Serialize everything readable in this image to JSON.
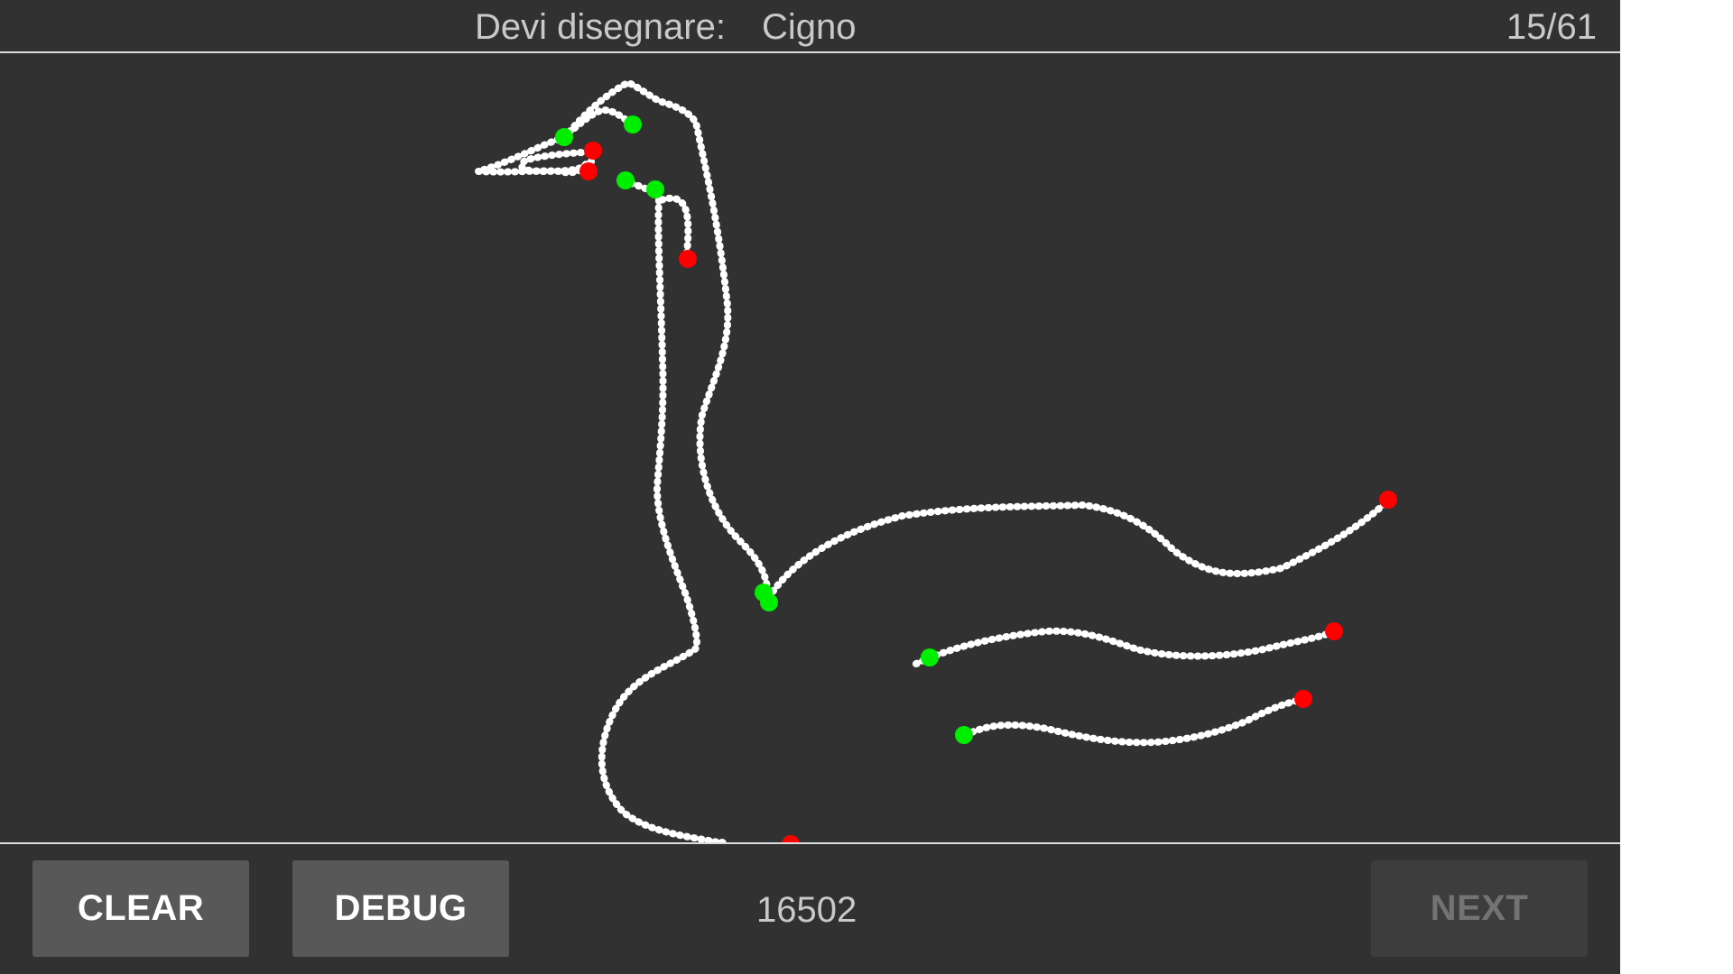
{
  "header": {
    "prompt_label": "Devi disegnare:",
    "prompt_word": "Cigno",
    "progress": "15/61"
  },
  "footer": {
    "clear_label": "CLEAR",
    "debug_label": "DEBUG",
    "score": "16502",
    "next_label": "NEXT"
  },
  "colors": {
    "background": "#313131",
    "stroke": "#ffffff",
    "stroke_start": "#00ee00",
    "stroke_end": "#ff0000"
  }
}
